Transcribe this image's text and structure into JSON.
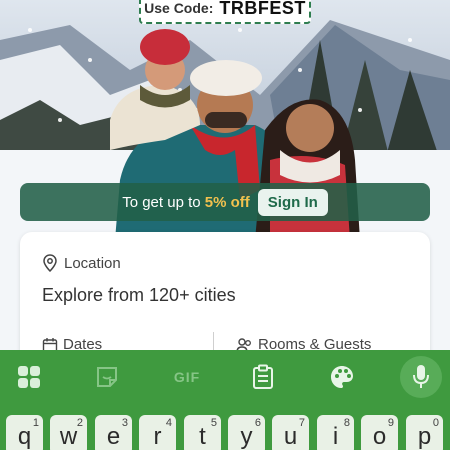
{
  "promo": {
    "label": "Use Code:",
    "code": "TRBFEST"
  },
  "offer": {
    "text_prefix": "To get up to",
    "percent": "5% off",
    "signin_label": "Sign In"
  },
  "search_card": {
    "location_label": "Location",
    "location_value": "Explore from 120+ cities",
    "dates_label": "Dates",
    "rooms_label": "Rooms & Guests"
  },
  "keyboard": {
    "toolbar": {
      "icons": [
        "apps-grid-icon",
        "sticker-icon",
        "gif-icon",
        "clipboard-icon",
        "palette-icon",
        "mic-icon"
      ],
      "gif_label": "GIF"
    },
    "keys": [
      {
        "char": "q",
        "num": "1"
      },
      {
        "char": "w",
        "num": "2"
      },
      {
        "char": "e",
        "num": "3"
      },
      {
        "char": "r",
        "num": "4"
      },
      {
        "char": "t",
        "num": "5"
      },
      {
        "char": "y",
        "num": "6"
      },
      {
        "char": "u",
        "num": "7"
      },
      {
        "char": "i",
        "num": "8"
      },
      {
        "char": "o",
        "num": "9"
      },
      {
        "char": "p",
        "num": "0"
      }
    ]
  },
  "colors": {
    "brand_green": "#226048",
    "offer_accent": "#f2c14e",
    "keyboard_bg": "#3f9a3f"
  }
}
